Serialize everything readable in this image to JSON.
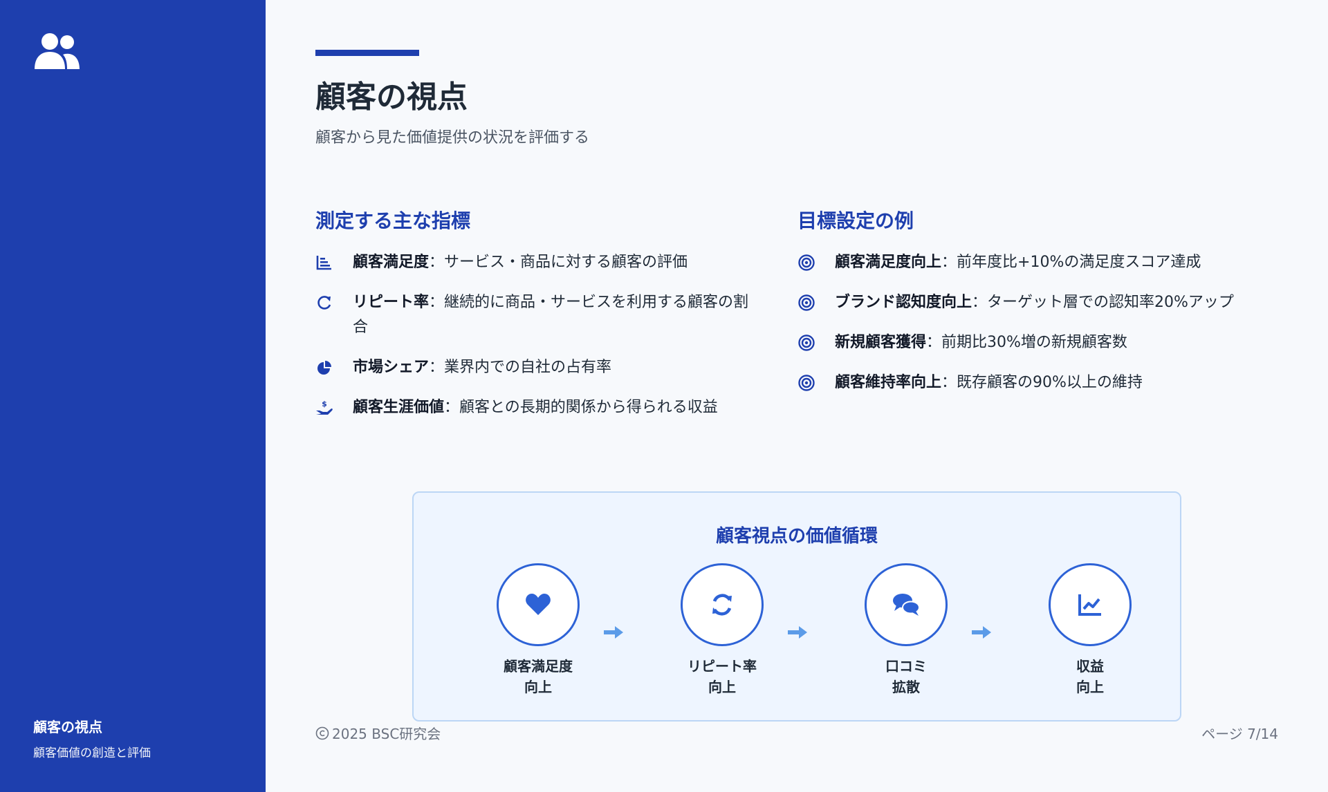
{
  "sidebar": {
    "logo_icon": "users-icon",
    "footer_title": "顧客の視点",
    "footer_subtitle": "顧客価値の創造と評価"
  },
  "header": {
    "title": "顧客の視点",
    "subtitle": "顧客から見た価値提供の状況を評価する"
  },
  "indicators": {
    "heading": "測定する主な指標",
    "items": [
      {
        "icon": "bar-chart-icon",
        "term": "顧客満足度",
        "sep": "：",
        "desc": "サービス・商品に対する顧客の評価"
      },
      {
        "icon": "redo-icon",
        "term": "リピート率",
        "sep": "：",
        "desc": "継続的に商品・サービスを利用する顧客の割合"
      },
      {
        "icon": "pie-chart-icon",
        "term": "市場シェア",
        "sep": "：",
        "desc": "業界内での自社の占有率"
      },
      {
        "icon": "hand-dollar-icon",
        "term": "顧客生涯価値",
        "sep": "：",
        "desc": "顧客との長期的関係から得られる収益"
      }
    ]
  },
  "goals": {
    "heading": "目標設定の例",
    "items": [
      {
        "icon": "target-icon",
        "term": "顧客満足度向上",
        "sep": "：",
        "desc": "前年度比+10%の満足度スコア達成"
      },
      {
        "icon": "target-icon",
        "term": "ブランド認知度向上",
        "sep": "：",
        "desc": "ターゲット層での認知率20%アップ"
      },
      {
        "icon": "target-icon",
        "term": "新規顧客獲得",
        "sep": "：",
        "desc": "前期比30%増の新規顧客数"
      },
      {
        "icon": "target-icon",
        "term": "顧客維持率向上",
        "sep": "：",
        "desc": "既存顧客の90%以上の維持"
      }
    ]
  },
  "cycle": {
    "title": "顧客視点の価値循環",
    "steps": [
      {
        "icon": "heart-icon",
        "line1": "顧客満足度",
        "line2": "向上"
      },
      {
        "icon": "sync-icon",
        "line1": "リピート率",
        "line2": "向上"
      },
      {
        "icon": "comments-icon",
        "line1": "口コミ",
        "line2": "拡散"
      },
      {
        "icon": "chart-line-icon",
        "line1": "収益",
        "line2": "向上"
      }
    ]
  },
  "footer": {
    "copyright": "2025 BSC研究会",
    "page": "ページ 7/14"
  },
  "colors": {
    "primary": "#1e3fae",
    "accent": "#2d62d6",
    "arrow": "#5b9be8",
    "panel_bg": "#eef5ff"
  }
}
